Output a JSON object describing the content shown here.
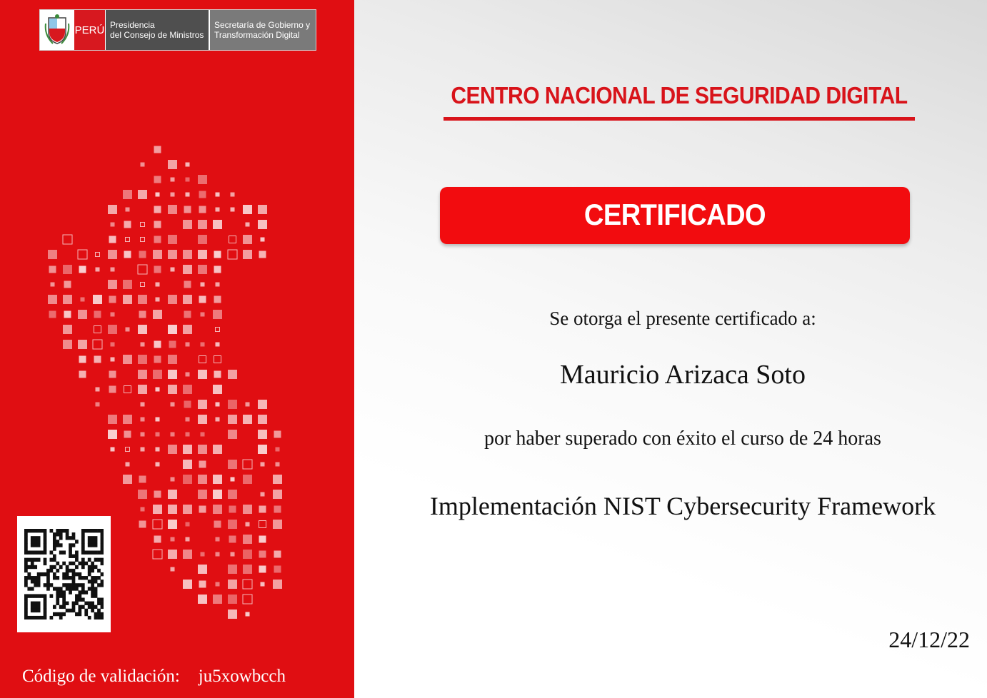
{
  "logo": {
    "country": "PERÚ",
    "org_line1": "Presidencia",
    "org_line2": "del Consejo de Ministros",
    "sec_line1": "Secretaría de Gobierno y",
    "sec_line2": "Transformación Digital"
  },
  "header": {
    "title": "CENTRO NACIONAL DE SEGURIDAD DIGITAL"
  },
  "certificate": {
    "banner": "CERTIFICADO",
    "grant_text": "Se otorga el presente certificado a:",
    "recipient": "Mauricio Arizaca Soto",
    "reason": "por haber superado con éxito el curso de 24 horas",
    "course": "Implementación NIST Cybersecurity Framework",
    "date": "24/12/22"
  },
  "validation": {
    "label": "Código de validación:",
    "code": "ju5xowbcch"
  },
  "colors": {
    "primary_red": "#e00e12",
    "banner_red": "#f20c0f",
    "title_red": "#d8131a"
  },
  "icons": {
    "coat_of_arms": "peru-coat-of-arms-icon",
    "map": "peru-map-icon",
    "qr": "qr-code-icon"
  }
}
